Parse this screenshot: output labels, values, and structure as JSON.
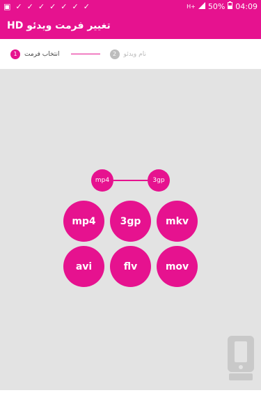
{
  "status_bar": {
    "left_icons": [
      "image-icon",
      "check-icon",
      "check-icon",
      "check-icon",
      "check-icon",
      "check-icon",
      "check-icon",
      "check-icon"
    ],
    "network": "H+",
    "battery": "50%",
    "time": "04:09"
  },
  "app_bar": {
    "title": "تغییر فرمت ویدئو HD"
  },
  "stepper": {
    "steps": [
      {
        "number": "1",
        "label": "انتخاب فرمت"
      },
      {
        "number": "2",
        "label": "نام ویدئو"
      }
    ]
  },
  "conversion": {
    "from": "mp4",
    "to": "3gp"
  },
  "formats": [
    "mp4",
    "3gp",
    "mkv",
    "avi",
    "flv",
    "mov"
  ],
  "colors": {
    "accent": "#e6128f",
    "background": "#e3e3e3"
  }
}
